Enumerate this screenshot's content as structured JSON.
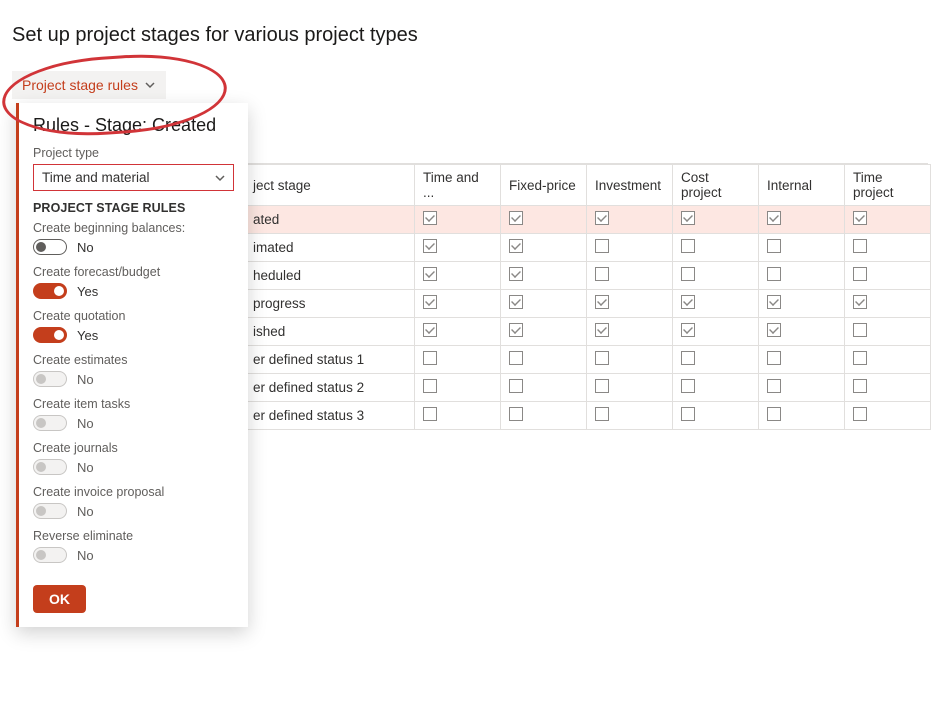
{
  "page": {
    "title": "Set up project stages for various project types",
    "dropdown_label": "Project stage rules"
  },
  "panel": {
    "title": "Rules - Stage: Created",
    "project_type_label": "Project type",
    "project_type_value": "Time and material",
    "section_head": "PROJECT STAGE RULES",
    "ok_label": "OK",
    "rules": [
      {
        "label": "Create beginning balances:",
        "state": "off",
        "value": "No"
      },
      {
        "label": "Create forecast/budget",
        "state": "on",
        "value": "Yes"
      },
      {
        "label": "Create quotation",
        "state": "on",
        "value": "Yes"
      },
      {
        "label": "Create estimates",
        "state": "disabled",
        "value": "No"
      },
      {
        "label": "Create item tasks",
        "state": "disabled",
        "value": "No"
      },
      {
        "label": "Create journals",
        "state": "disabled",
        "value": "No"
      },
      {
        "label": "Create invoice proposal",
        "state": "disabled",
        "value": "No"
      },
      {
        "label": "Reverse eliminate",
        "state": "disabled",
        "value": "No"
      }
    ]
  },
  "grid": {
    "headers": [
      "ject stage",
      "Time and ...",
      "Fixed-price",
      "Investment",
      "Cost project",
      "Internal",
      "Time project"
    ],
    "rows": [
      {
        "stage": "ated",
        "selected": true,
        "checks": [
          true,
          true,
          true,
          true,
          true,
          true
        ]
      },
      {
        "stage": "imated",
        "selected": false,
        "checks": [
          true,
          true,
          false,
          false,
          false,
          false
        ]
      },
      {
        "stage": "heduled",
        "selected": false,
        "checks": [
          true,
          true,
          false,
          false,
          false,
          false
        ]
      },
      {
        "stage": "progress",
        "selected": false,
        "checks": [
          true,
          true,
          true,
          true,
          true,
          true
        ]
      },
      {
        "stage": "ished",
        "selected": false,
        "checks": [
          true,
          true,
          true,
          true,
          true,
          false
        ]
      },
      {
        "stage": "er defined status 1",
        "selected": false,
        "checks": [
          false,
          false,
          false,
          false,
          false,
          false
        ]
      },
      {
        "stage": "er defined status 2",
        "selected": false,
        "checks": [
          false,
          false,
          false,
          false,
          false,
          false
        ]
      },
      {
        "stage": "er defined status 3",
        "selected": false,
        "checks": [
          false,
          false,
          false,
          false,
          false,
          false
        ]
      }
    ]
  }
}
